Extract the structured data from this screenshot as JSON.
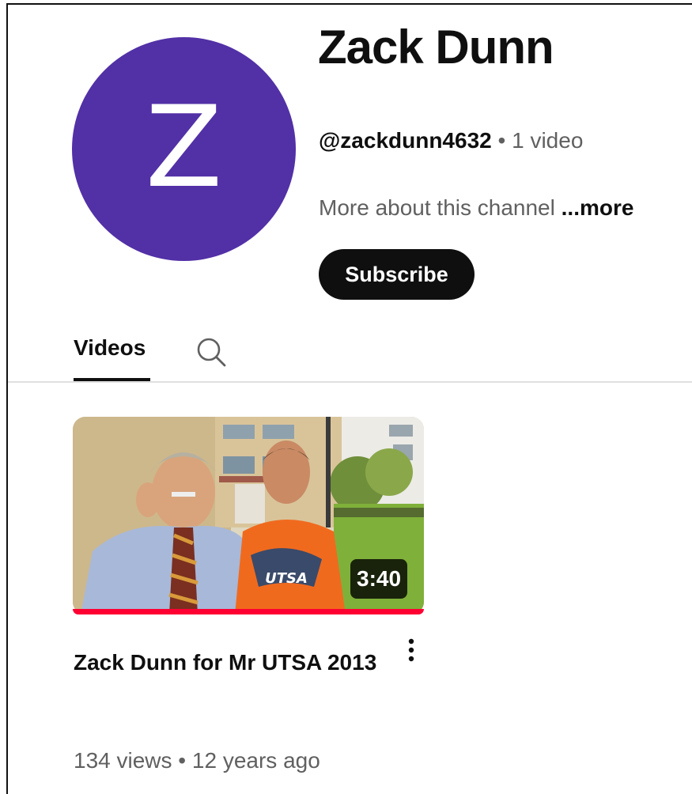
{
  "channel": {
    "avatar_letter": "Z",
    "avatar_color": "#5230a6",
    "name": "Zack Dunn",
    "handle": "@zackdunn4632",
    "separator": " • ",
    "video_count": "1 video",
    "about_text": "More about this channel",
    "about_more": " ...more",
    "subscribe_label": "Subscribe"
  },
  "tabs": {
    "videos_label": "Videos",
    "search_icon": "search-icon"
  },
  "video": {
    "title": "Zack Dunn for Mr UTSA 2013",
    "duration": "3:40",
    "views": "134 views",
    "separator": " • ",
    "age": "12 years ago",
    "watched_fraction": 1.0,
    "shirt_text": "UTSA",
    "menu_icon": "kebab-menu-icon"
  },
  "colors": {
    "progress": "#ff0033",
    "button_bg": "#0f0f0f",
    "secondary_text": "#606060"
  }
}
